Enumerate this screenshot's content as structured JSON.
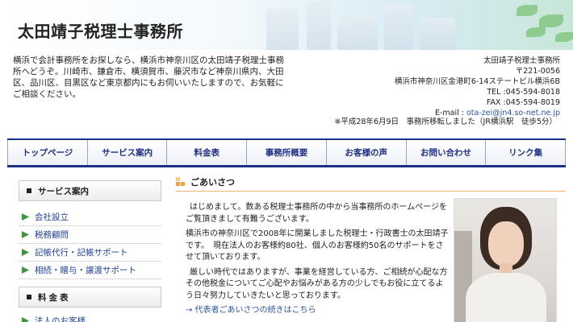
{
  "header": {
    "title": "太田靖子税理士事務所"
  },
  "intro": {
    "text": "横浜で会計事務所をお探しなら、横浜市神奈川区の太田靖子税理士事務所へどうぞ。川崎市、鎌倉市、横須賀市、藤沢市など神奈川県内、大田区、品川区、目黒区など東京都内にもお伺いいたしますので、お気軽にご相談ください。"
  },
  "contact": {
    "name": "太田靖子税理士事務所",
    "postal": "〒221-0056",
    "address": "横浜市神奈川区金港町6-14ステートビル横浜6B",
    "tel": "TEL :045-594-8018",
    "fax": "FAX :045-594-8019",
    "email_label": "E-mail :",
    "email": "ota-zei@jn4.so-net.ne.jp"
  },
  "notice": "※平成28年6月9日　事務所移転しました（JR横浜駅　徒歩5分）",
  "nav": {
    "items": [
      {
        "label": "トップページ"
      },
      {
        "label": "サービス案内"
      },
      {
        "label": "料金表"
      },
      {
        "label": "事務所概要"
      },
      {
        "label": "お客様の声"
      },
      {
        "label": "お問い合わせ"
      },
      {
        "label": "リンク集"
      }
    ]
  },
  "sidebar": {
    "services_heading": "サービス案内",
    "services": [
      {
        "label": "会社設立"
      },
      {
        "label": "税務顧問"
      },
      {
        "label": "記帳代行・記帳サポート"
      },
      {
        "label": "相続・贈与・譲渡サポート"
      }
    ],
    "fees_heading": "料金表",
    "fees": [
      {
        "label": "法人のお客様"
      }
    ]
  },
  "main": {
    "heading": "ごあいさつ",
    "p1": "はじめまして。数ある税理士事務所の中から当事務所のホームページをご覧頂きまして有難うございます。",
    "p2": "横浜市の神奈川区で2008年に開業しました税理士・行政書士の太田靖子です。　現在法人のお客様約80社、個人のお客様約50名のサポートをさせて頂いております。",
    "p3": "厳しい時代ではありますが、事業を経営している方、ご相続が心配な方その他税金についてご心配やお悩みがある方の少しでもお役に立てるよう日々努力していきたいと思っております。",
    "more_link": "→ 代表者ごあいさつの続きはこちら"
  },
  "colors": {
    "nav_accent": "#1d2f86",
    "link": "#2a55a8",
    "sidebar_link": "#1d3f9a",
    "arrow": "#3a9a3a",
    "heading_rule": "#f0b070"
  }
}
